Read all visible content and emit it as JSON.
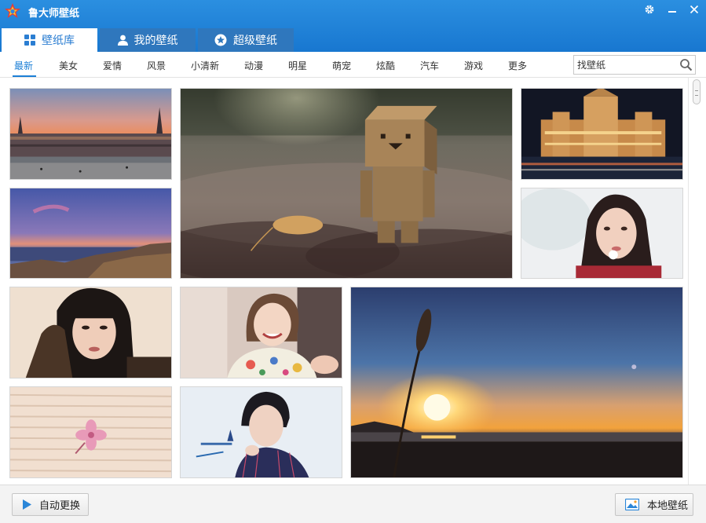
{
  "app": {
    "title": "鲁大师壁纸",
    "logo_icon": "star-logo-icon",
    "brand_color": "#1b7dd4"
  },
  "window_controls": {
    "settings_icon": "gear-icon",
    "minimize_icon": "minimize-icon",
    "close_icon": "close-icon"
  },
  "tabs": [
    {
      "label": "壁纸库",
      "icon": "grid-icon",
      "active": true
    },
    {
      "label": "我的壁纸",
      "icon": "user-icon",
      "active": false
    },
    {
      "label": "超级壁纸",
      "icon": "star-circle-icon",
      "active": false
    }
  ],
  "categories": [
    {
      "label": "最新",
      "active": true
    },
    {
      "label": "美女"
    },
    {
      "label": "爱情"
    },
    {
      "label": "风景"
    },
    {
      "label": "小清新"
    },
    {
      "label": "动漫"
    },
    {
      "label": "明星"
    },
    {
      "label": "萌宠"
    },
    {
      "label": "炫酷"
    },
    {
      "label": "汽车"
    },
    {
      "label": "游戏"
    },
    {
      "label": "更多"
    }
  ],
  "search": {
    "value": "找壁纸",
    "icon": "search-icon"
  },
  "wallpapers": [
    {
      "subject": "city square at sunset"
    },
    {
      "subject": "cardboard robot figure on cobblestone road"
    },
    {
      "subject": "palace lit up at night"
    },
    {
      "subject": "rocky coast at dusk"
    },
    {
      "subject": "woman with flower"
    },
    {
      "subject": "woman with long black hair"
    },
    {
      "subject": "smiling woman in floral dress"
    },
    {
      "subject": "sunset over the sea with grass silhouette"
    },
    {
      "subject": "pink flower on wooden planks"
    },
    {
      "subject": "man in striped suit"
    }
  ],
  "footer": {
    "auto_change_label": "自动更换",
    "auto_change_icon": "play-icon",
    "local_wallpaper_label": "本地壁纸",
    "local_wallpaper_icon": "picture-icon"
  }
}
